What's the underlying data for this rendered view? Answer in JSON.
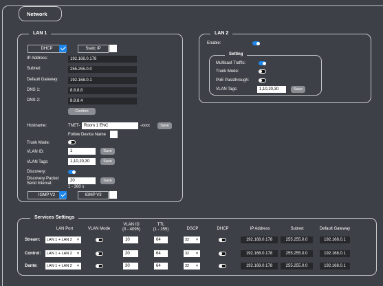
{
  "tab": {
    "label": "Network"
  },
  "lan1": {
    "title": "LAN 1",
    "dhcp_label": "DHCP",
    "static_ip_label": "Static IP",
    "ip_label": "IP Address:",
    "ip_value": "192.168.0.178",
    "subnet_label": "Subnet:",
    "subnet_value": "255.255.0.0",
    "gateway_label": "Default Gateway:",
    "gateway_value": "192.168.0.1",
    "dns1_label": "DNS 1:",
    "dns1_value": "8.8.8.8",
    "dns2_label": "DNS 2:",
    "dns2_value": "8.8.8.4",
    "confirm_label": "Confirm",
    "hostname_label": "Hostname:",
    "hostname_prefix": "TNET-",
    "hostname_value": "Room 1 ENC",
    "hostname_suffix": "-xxxx",
    "save_label": "Save",
    "follow_label": "Follow Device Name",
    "trunk_label": "Trunk Mode:",
    "vlan_id_label": "VLAN ID:",
    "vlan_id_value": "1",
    "vlan_tags_label": "VLAN Tags:",
    "vlan_tags_value": "1,10,20,30",
    "discovery_label": "Discovery:",
    "discovery_interval_label1": "Discovery Packet",
    "discovery_interval_label2": "Send Interval:",
    "discovery_interval_value": "20",
    "discovery_range": "1 - 360 s",
    "igmp_v2_label": "IGMP V2",
    "igmp_v3_label": "IGMP V3"
  },
  "lan2": {
    "title": "LAN 2",
    "enable_label": "Enable:",
    "setting_title": "Setting",
    "multicast_label": "Multicast Traffic:",
    "trunk_label": "Trunk Mode:",
    "poe_label": "PoE Passthrough:",
    "vlan_tags_label": "VLAN Tags:",
    "vlan_tags_value": "1,10,20,30",
    "save_label": "Save"
  },
  "services": {
    "title": "Services Settings",
    "headers": {
      "lan_port": "LAN Port",
      "vlan_mode": "VLAN Mode",
      "vlan_id1": "VLAN ID",
      "vlan_id2": "(0 - 4095)",
      "ttl1": "TTL",
      "ttl2": "(1 - 255)",
      "dscp": "DSCP",
      "dhcp": "DHCP",
      "ip": "IP Address",
      "subnet": "Subnet",
      "gateway": "Default Gateway"
    },
    "rows": [
      {
        "name": "Stream:",
        "lan_port": "LAN 1 + LAN 2",
        "vlan_id": "10",
        "ttl": "64",
        "dscp": "32",
        "ip": "192.168.0.178",
        "subnet": "255.255.0.0",
        "gateway": "192.168.0.1"
      },
      {
        "name": "Control:",
        "lan_port": "LAN 1 + LAN 2",
        "vlan_id": "20",
        "ttl": "64",
        "dscp": "32",
        "ip": "192.168.0.178",
        "subnet": "255.255.0.0",
        "gateway": "192.168.0.1"
      },
      {
        "name": "Dante:",
        "lan_port": "LAN 1 + LAN 2",
        "vlan_id": "30",
        "ttl": "64",
        "dscp": "32",
        "ip": "192.168.0.178",
        "subnet": "255.255.0.0",
        "gateway": "192.168.0.1"
      }
    ]
  },
  "colors": {
    "accent": "#1d86e8",
    "background": "#3d4046",
    "button": "#8a8d92"
  }
}
